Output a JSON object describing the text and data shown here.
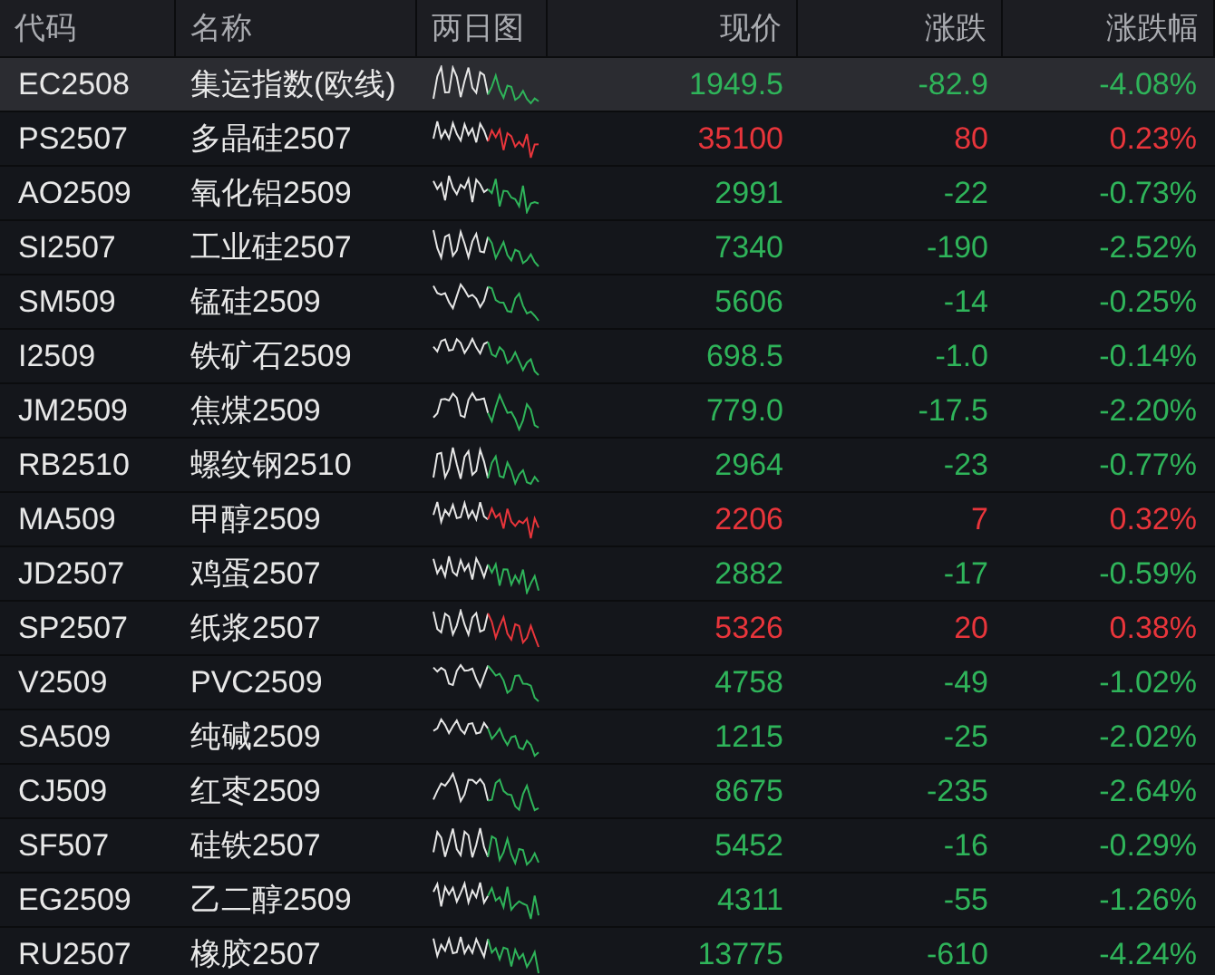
{
  "table": {
    "columns": [
      "代码",
      "名称",
      "两日图",
      "现价",
      "涨跌",
      "涨跌幅"
    ],
    "rows": [
      {
        "code": "EC2508",
        "name": "集运指数(欧线)",
        "price": "1949.5",
        "change": "-82.9",
        "pct": "-4.08%",
        "color": "#2fb45a",
        "selected": true
      },
      {
        "code": "PS2507",
        "name": "多晶硅2507",
        "price": "35100",
        "change": "80",
        "pct": "0.23%",
        "color": "#e8353b",
        "selected": false
      },
      {
        "code": "AO2509",
        "name": "氧化铝2509",
        "price": "2991",
        "change": "-22",
        "pct": "-0.73%",
        "color": "#2fb45a",
        "selected": false
      },
      {
        "code": "SI2507",
        "name": "工业硅2507",
        "price": "7340",
        "change": "-190",
        "pct": "-2.52%",
        "color": "#2fb45a",
        "selected": false
      },
      {
        "code": "SM509",
        "name": "锰硅2509",
        "price": "5606",
        "change": "-14",
        "pct": "-0.25%",
        "color": "#2fb45a",
        "selected": false
      },
      {
        "code": "I2509",
        "name": "铁矿石2509",
        "price": "698.5",
        "change": "-1.0",
        "pct": "-0.14%",
        "color": "#2fb45a",
        "selected": false
      },
      {
        "code": "JM2509",
        "name": "焦煤2509",
        "price": "779.0",
        "change": "-17.5",
        "pct": "-2.20%",
        "color": "#2fb45a",
        "selected": false
      },
      {
        "code": "RB2510",
        "name": "螺纹钢2510",
        "price": "2964",
        "change": "-23",
        "pct": "-0.77%",
        "color": "#2fb45a",
        "selected": false
      },
      {
        "code": "MA509",
        "name": "甲醇2509",
        "price": "2206",
        "change": "7",
        "pct": "0.32%",
        "color": "#e8353b",
        "selected": false
      },
      {
        "code": "JD2507",
        "name": "鸡蛋2507",
        "price": "2882",
        "change": "-17",
        "pct": "-0.59%",
        "color": "#2fb45a",
        "selected": false
      },
      {
        "code": "SP2507",
        "name": "纸浆2507",
        "price": "5326",
        "change": "20",
        "pct": "0.38%",
        "color": "#e8353b",
        "selected": false
      },
      {
        "code": "V2509",
        "name": "PVC2509",
        "price": "4758",
        "change": "-49",
        "pct": "-1.02%",
        "color": "#2fb45a",
        "selected": false
      },
      {
        "code": "SA509",
        "name": "纯碱2509",
        "price": "1215",
        "change": "-25",
        "pct": "-2.02%",
        "color": "#2fb45a",
        "selected": false
      },
      {
        "code": "CJ509",
        "name": "红枣2509",
        "price": "8675",
        "change": "-235",
        "pct": "-2.64%",
        "color": "#2fb45a",
        "selected": false
      },
      {
        "code": "SF507",
        "name": "硅铁2507",
        "price": "5452",
        "change": "-16",
        "pct": "-0.29%",
        "color": "#2fb45a",
        "selected": false
      },
      {
        "code": "EG2509",
        "name": "乙二醇2509",
        "price": "4311",
        "change": "-55",
        "pct": "-1.26%",
        "color": "#2fb45a",
        "selected": false
      },
      {
        "code": "RU2507",
        "name": "橡胶2507",
        "price": "13775",
        "change": "-610",
        "pct": "-4.24%",
        "color": "#2fb45a",
        "selected": false
      }
    ]
  }
}
